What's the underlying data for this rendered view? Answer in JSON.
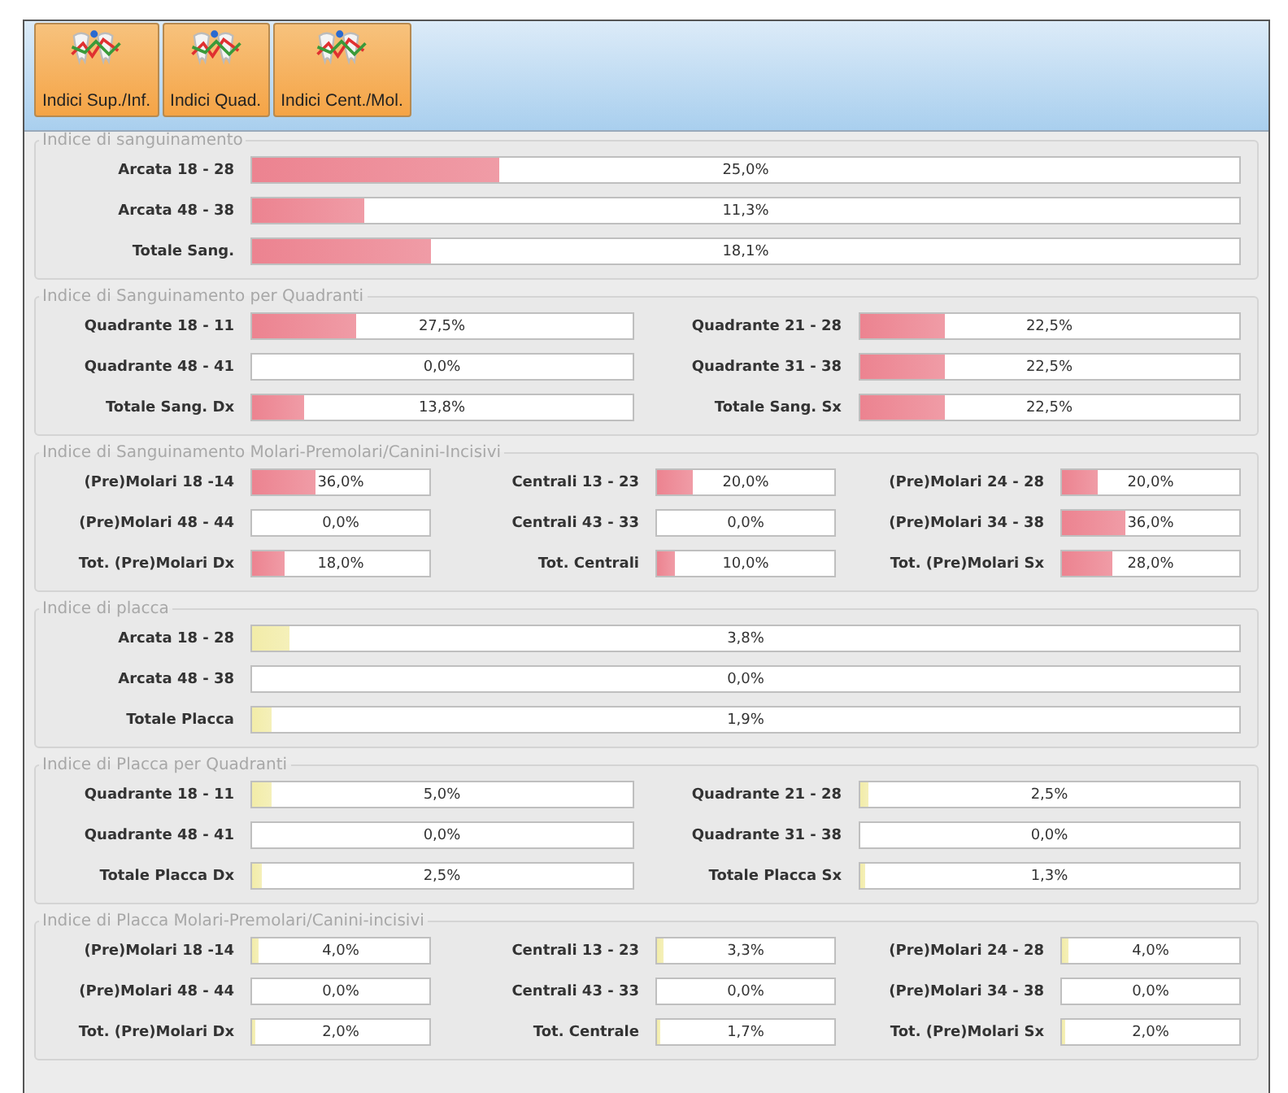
{
  "toolbar": {
    "buttons": [
      {
        "label": "Indici Sup./Inf."
      },
      {
        "label": "Indici Quad."
      },
      {
        "label": "Indici Cent./Mol."
      }
    ]
  },
  "sections": [
    {
      "title": "Indice di sanguinamento",
      "kind": "full",
      "color": "#ec8390",
      "rows": [
        {
          "label": "Arcata 18 - 28",
          "reading": "25,0%",
          "level": 0.25
        },
        {
          "label": "Arcata 48 - 38",
          "reading": "11,3%",
          "level": 0.113
        },
        {
          "label": "Totale Sang.",
          "reading": "18,1%",
          "level": 0.181
        }
      ]
    },
    {
      "title": "Indice di Sanguinamento per Quadranti",
      "kind": "two",
      "color": "#ec8390",
      "rows": [
        {
          "label": "Quadrante 18 - 11",
          "reading": "27,5%",
          "level": 0.275
        },
        {
          "label": "Quadrante 21 - 28",
          "reading": "22,5%",
          "level": 0.225
        },
        {
          "label": "Quadrante 48 - 41",
          "reading": "0,0%"
        },
        {
          "label": "Quadrante 31 - 38",
          "reading": "22,5%",
          "level": 0.225
        },
        {
          "label": "Totale Sang. Dx",
          "reading": "13,8%",
          "level": 0.138
        },
        {
          "label": "Totale Sang. Sx",
          "reading": "22,5%",
          "level": 0.225
        }
      ]
    },
    {
      "title": "Indice di Sanguinamento Molari-Premolari/Canini-Incisivi",
      "kind": "three",
      "color": "#ec8390",
      "rows": [
        {
          "label": "(Pre)Molari 18 -14",
          "reading": "36,0%",
          "level": 0.36
        },
        {
          "label": "Centrali 13 - 23",
          "reading": "20,0%",
          "level": 0.2
        },
        {
          "label": "(Pre)Molari 24 - 28",
          "reading": "20,0%",
          "level": 0.2
        },
        {
          "label": "(Pre)Molari 48 - 44",
          "reading": "0,0%"
        },
        {
          "label": "Centrali 43 - 33",
          "reading": "0,0%"
        },
        {
          "label": "(Pre)Molari 34 - 38",
          "reading": "36,0%",
          "level": 0.36
        },
        {
          "label": "Tot. (Pre)Molari Dx",
          "reading": "18,0%",
          "level": 0.18
        },
        {
          "label": "Tot. Centrali",
          "reading": "10,0%",
          "level": 0.1
        },
        {
          "label": "Tot. (Pre)Molari Sx",
          "reading": "28,0%",
          "level": 0.28
        }
      ]
    },
    {
      "title": "Indice di placca",
      "kind": "full",
      "color": "#f2eca8",
      "rows": [
        {
          "label": "Arcata 18 - 28",
          "reading": "3,8%",
          "level": 0.038
        },
        {
          "label": "Arcata 48 - 38",
          "reading": "0,0%"
        },
        {
          "label": "Totale Placca",
          "reading": "1,9%",
          "level": 0.019
        }
      ]
    },
    {
      "title": "Indice di Placca per Quadranti",
      "kind": "two",
      "color": "#f2eca8",
      "rows": [
        {
          "label": "Quadrante 18 - 11",
          "reading": "5,0%",
          "level": 0.05
        },
        {
          "label": "Quadrante 21 - 28",
          "reading": "2,5%",
          "level": 0.025
        },
        {
          "label": "Quadrante 48 - 41",
          "reading": "0,0%"
        },
        {
          "label": "Quadrante 31 - 38",
          "reading": "0,0%"
        },
        {
          "label": "Totale Placca Dx",
          "reading": "2,5%",
          "level": 0.025
        },
        {
          "label": "Totale Placca Sx",
          "reading": "1,3%",
          "level": 0.013
        }
      ]
    },
    {
      "title": "Indice di Placca Molari-Premolari/Canini-incisivi",
      "kind": "three",
      "color": "#f2eca8",
      "rows": [
        {
          "label": "(Pre)Molari 18 -14",
          "reading": "4,0%",
          "level": 0.04
        },
        {
          "label": "Centrali 13 - 23",
          "reading": "3,3%",
          "level": 0.033
        },
        {
          "label": "(Pre)Molari 24 - 28",
          "reading": "4,0%",
          "level": 0.04
        },
        {
          "label": "(Pre)Molari 48 - 44",
          "reading": "0,0%"
        },
        {
          "label": "Centrali 43 - 33",
          "reading": "0,0%"
        },
        {
          "label": "(Pre)Molari 34 - 38",
          "reading": "0,0%"
        },
        {
          "label": "Tot. (Pre)Molari Dx",
          "reading": "2,0%",
          "level": 0.02
        },
        {
          "label": "Tot. Centrale",
          "reading": "1,7%",
          "level": 0.017
        },
        {
          "label": "Tot. (Pre)Molari Sx",
          "reading": "2,0%",
          "level": 0.02
        }
      ]
    }
  ]
}
